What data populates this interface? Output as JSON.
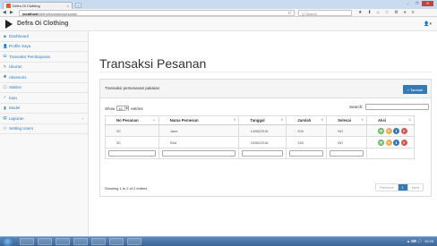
{
  "browser": {
    "tab_title": "Defra Oi Clothing",
    "tab_close": "×",
    "new_tab": "+",
    "win_min": "–",
    "win_max": "❐",
    "win_close": "✕",
    "back": "◀",
    "forward": "▶",
    "url_host": "localhost",
    "url_path": "/defra/transaksi/pesanan",
    "reload": "C",
    "search_placeholder": "Q  Search",
    "toolbar_icons": [
      "★",
      "⬇",
      "⌂",
      "☆",
      "⚙",
      "●",
      "≡"
    ]
  },
  "header": {
    "brand": "Defra Oi Clothing",
    "user_menu": "👤▾"
  },
  "sidebar": {
    "items": [
      {
        "icon": "◙",
        "label": "Dashboard"
      },
      {
        "icon": "👤",
        "label": "Profile Saya"
      },
      {
        "icon": "⛁",
        "label": "Transaksi Pembayaran"
      },
      {
        "icon": "✎",
        "label": "Ukuran"
      },
      {
        "icon": "✱",
        "label": "Aksesoris"
      },
      {
        "icon": "☐",
        "label": "Sablon"
      },
      {
        "icon": "✓",
        "label": "Kain"
      },
      {
        "icon": "▮",
        "label": "Model"
      },
      {
        "icon": "▤",
        "label": "Laporan",
        "chevron": "›"
      },
      {
        "icon": "⚇",
        "label": "Setting Users"
      }
    ]
  },
  "main": {
    "title": "Transaksi Pesanan",
    "panel_title": "Transaksi pemesanan pakaian",
    "add_button": "+ Tambah",
    "show_label": "Show",
    "show_value": "10",
    "entries_label": "entries",
    "search_label": "Search:",
    "columns": [
      "No Pesanan",
      "Nama Pemesan",
      "Tanggal",
      "Jumlah",
      "Selesai",
      "Aksi"
    ],
    "rows": [
      {
        "no": "20",
        "nama": "Jane",
        "tanggal": "14/06/2016",
        "jumlah": "200",
        "selesai": "NO"
      },
      {
        "no": "30",
        "nama": "Siwi",
        "tanggal": "15/06/2016",
        "jumlah": "150",
        "selesai": "NO"
      }
    ],
    "action_icons": [
      "👁",
      "✎",
      "ℹ",
      "✕"
    ],
    "info": "Showing 1 to 2 of 2 entries",
    "pager": {
      "prev": "Previous",
      "page": "1",
      "next": "Next"
    }
  },
  "taskbar": {
    "clock": "10:25",
    "tray": "▲ ⌨ 🔊"
  },
  "colors": {
    "primary": "#337ab7",
    "success": "#5cb85c",
    "warning": "#f0ad4e",
    "danger": "#d9534f"
  }
}
